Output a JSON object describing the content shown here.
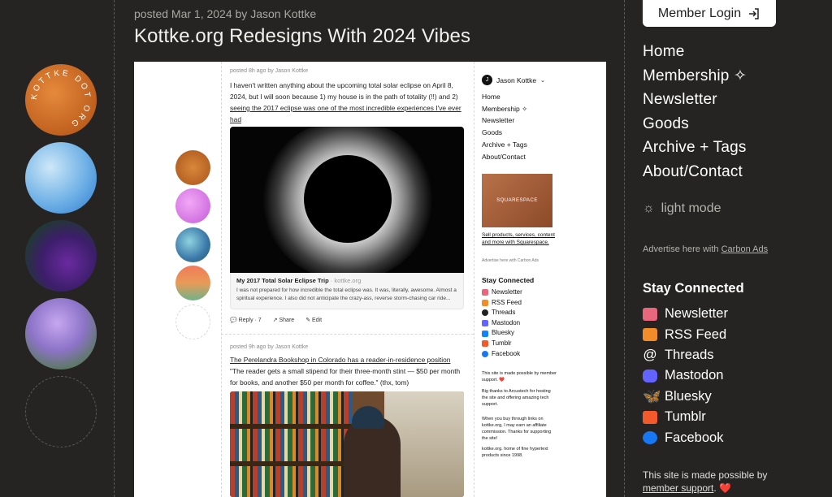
{
  "post": {
    "meta": "posted Mar 1, 2024 by Jason Kottke",
    "title": "Kottke.org Redesigns With 2024 Vibes"
  },
  "logo_text": "KOTTKE DOT ORG",
  "screenshot": {
    "post1": {
      "meta": "posted 8h ago by Jason Kottke",
      "text": "I haven't written anything about the upcoming total solar eclipse on April 8, 2024, but I will soon because 1) my house is in the path of totality (!!) and 2) ",
      "link": "seeing the 2017 eclipse was one of the most incredible experiences I've ever had",
      "caption_title": "My 2017 Total Solar Eclipse Trip",
      "caption_source": " · kottke.org",
      "caption_desc": "I was not prepared for how incredible the total eclipse was. It was, literally, awesome. Almost a spiritual experience. I also did not anticipate the crazy-ass, reverse storm-chasing car ride...",
      "reply": "Reply · 7",
      "share": "Share",
      "edit": "Edit"
    },
    "post2": {
      "meta": "posted 9h ago by Jason Kottke",
      "link": "The Perelandra Bookshop in Colorado has a reader-in-residence position",
      "text": "\"The reader gets a small stipend for their three-month stint — $50 per month for books, and another $50 per month for coffee.\" (thx, tom)"
    },
    "sidebar": {
      "user": "Jason Kottke",
      "nav": [
        "Home",
        "Membership",
        "Newsletter",
        "Goods",
        "Archive + Tags",
        "About/Contact"
      ],
      "ad_label": "SQUARESPACE",
      "ad_text": "Sell products, services, content and more with Squarespace.",
      "ad_note": "Advertise here with Carbon Ads",
      "stay_title": "Stay Connected",
      "stay": [
        "Newsletter",
        "RSS Feed",
        "Threads",
        "Mastodon",
        "Bluesky",
        "Tumblr",
        "Facebook"
      ],
      "support": "This site is made possible by member support. ❤️",
      "thanks": "Big thanks to Arcustech for hosting the site and offering amazing tech support.",
      "affiliate": "When you buy through links on kottke.org, I may earn an affiliate commission. Thanks for supporting the site!",
      "footer": "kottke.org. home of fine hypertext products since 1998."
    }
  },
  "right": {
    "login": "Member Login",
    "nav": [
      "Home",
      "Membership",
      "Newsletter",
      "Goods",
      "Archive + Tags",
      "About/Contact"
    ],
    "light_mode": "light mode",
    "advertise": "Advertise here with ",
    "carbon": "Carbon Ads",
    "stay_title": "Stay Connected",
    "stay": [
      "Newsletter",
      "RSS Feed",
      "Threads",
      "Mastodon",
      "Bluesky",
      "Tumblr",
      "Facebook"
    ],
    "support_prefix": "This site is made possible by",
    "support_link": "member support",
    "support_suffix": ". ❤️"
  },
  "colors": {
    "background": "#252422",
    "newsletter": "#e8677d",
    "rss": "#f28c28",
    "mastodon": "#6364ff",
    "bluesky": "#1185fe",
    "tumblr": "#f25a2c",
    "facebook": "#1877f2"
  }
}
